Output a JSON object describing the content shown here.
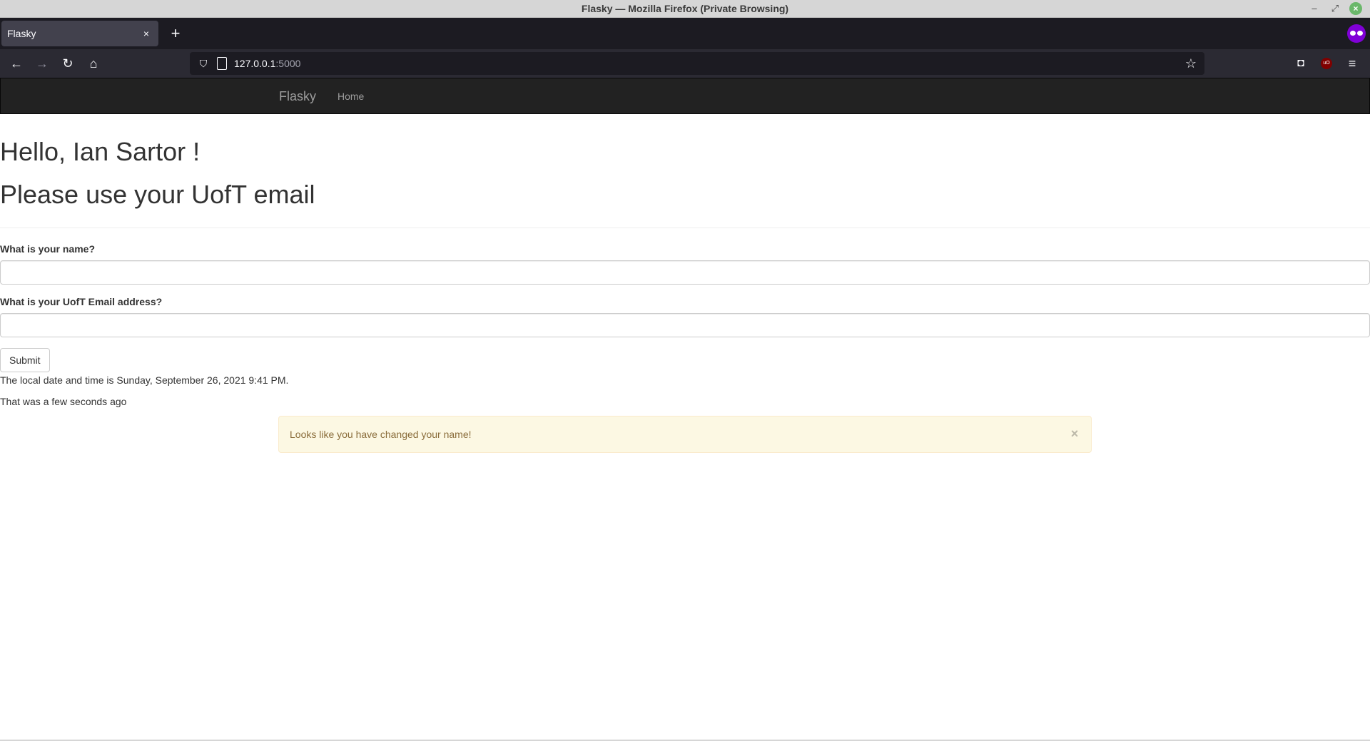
{
  "window": {
    "title": "Flasky — Mozilla Firefox (Private Browsing)",
    "minimize_icon": "minimize-icon",
    "restore_icon": "restore-icon",
    "close_icon": "close-icon"
  },
  "tabs": [
    {
      "label": "Flasky",
      "close": "×"
    }
  ],
  "toolbar": {
    "new_tab": "+",
    "back": "←",
    "forward": "→",
    "reload": "↻",
    "home": "⌂",
    "url_host": "127.0.0.1",
    "url_port": ":5000",
    "bookmark": "☆",
    "menu": "≡",
    "ublock_label": "uO"
  },
  "site": {
    "brand": "Flasky",
    "nav_home": "Home"
  },
  "page": {
    "greeting": "Hello, Ian Sartor !",
    "subtitle": "Please use your UofT email",
    "form": {
      "name_label": "What is your name?",
      "name_value": "",
      "email_label": "What is your UofT Email address?",
      "email_value": "",
      "submit_label": "Submit"
    },
    "datetime_text": "The local date and time is Sunday, September 26, 2021 9:41 PM.",
    "relative_time_text": "That was a few seconds ago",
    "alert": {
      "message": "Looks like you have changed your name!",
      "close": "×",
      "bg_color": "#fcf8e3",
      "text_color": "#8a6d3b"
    }
  }
}
